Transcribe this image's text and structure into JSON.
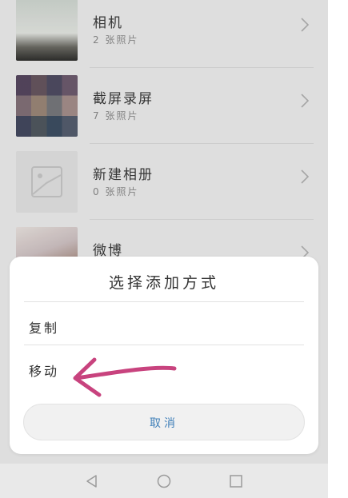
{
  "albums": [
    {
      "name": "相机",
      "count": "2 张照片"
    },
    {
      "name": "截屏录屏",
      "count": "7 张照片"
    },
    {
      "name": "新建相册",
      "count": "0 张照片"
    },
    {
      "name": "微博",
      "count": ""
    }
  ],
  "dialog": {
    "title": "选择添加方式",
    "options": [
      {
        "label": "复制"
      },
      {
        "label": "移动"
      }
    ],
    "cancel_label": "取消"
  },
  "navbar": {
    "icons": [
      "back-icon",
      "home-icon",
      "recents-icon"
    ]
  },
  "colors": {
    "annotation_arrow": "#c8437e",
    "cancel_text": "#3f7fb8"
  }
}
